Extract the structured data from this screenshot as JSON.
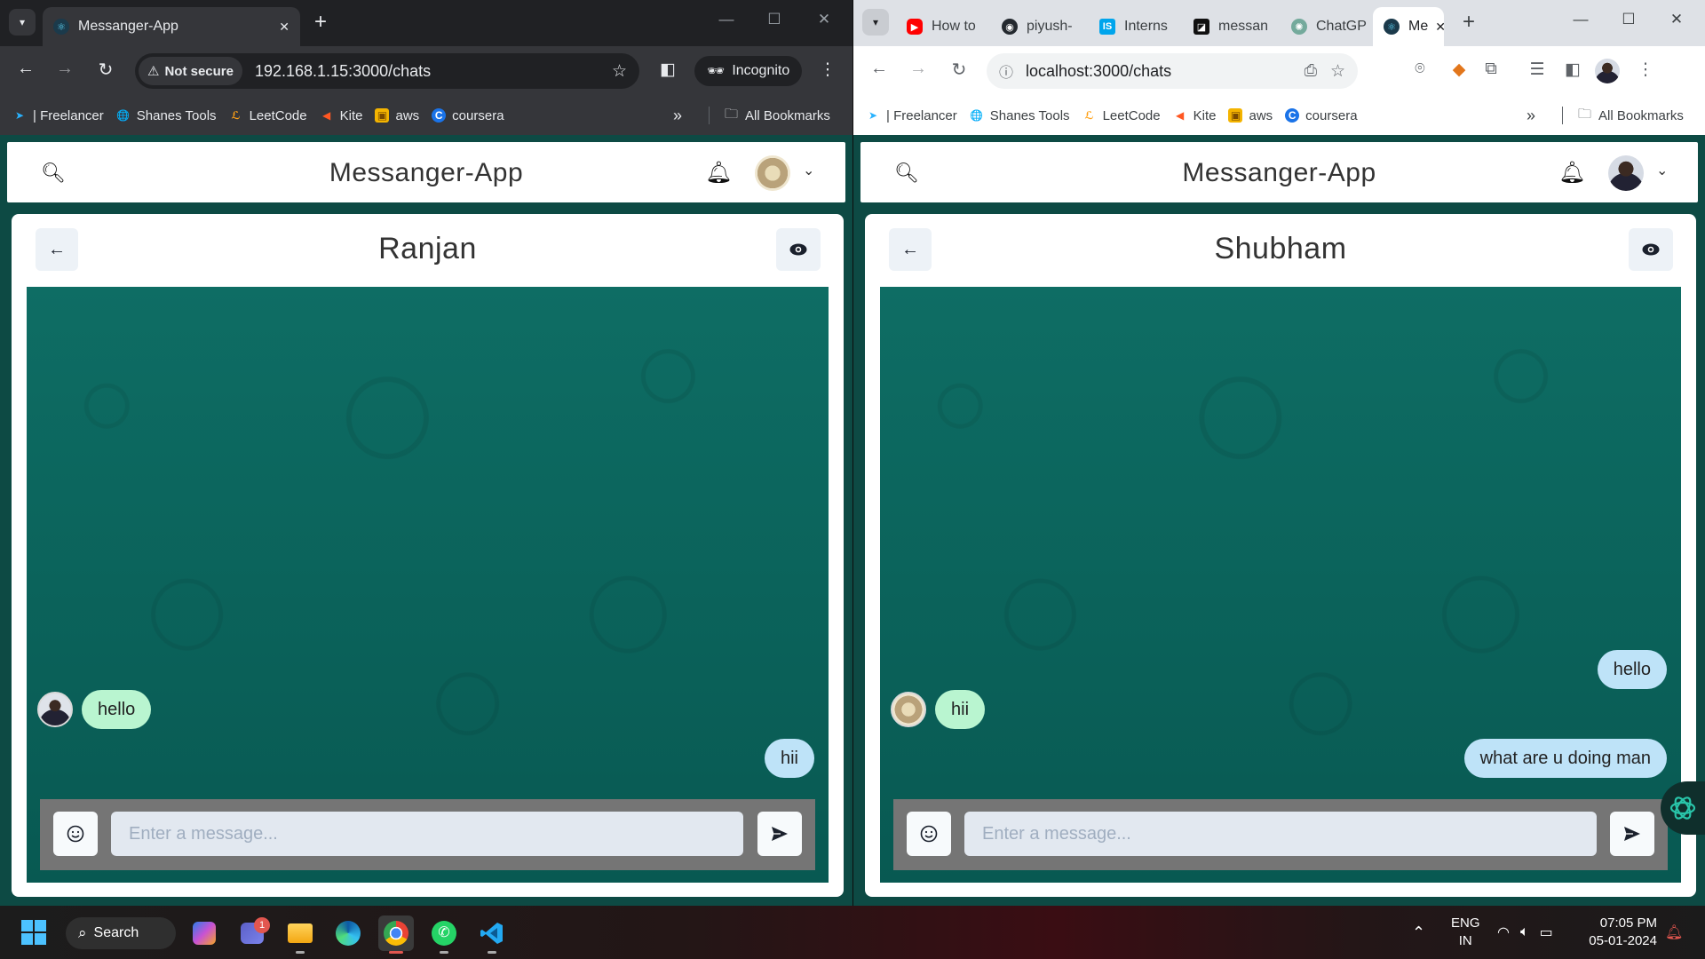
{
  "left_window": {
    "tab": {
      "title": "Messanger-App"
    },
    "address": {
      "security_label": "Not secure",
      "url": "192.168.1.15:3000/chats"
    },
    "incognito_label": "Incognito",
    "bookmarks": [
      "| Freelancer",
      "Shanes Tools",
      "LeetCode",
      "Kite",
      "aws",
      "coursera"
    ],
    "all_bookmarks": "All Bookmarks",
    "app": {
      "title": "Messanger-App",
      "chat": {
        "name": "Ranjan",
        "messages": [
          {
            "text": "hello",
            "direction": "in"
          },
          {
            "text": "hii",
            "direction": "out"
          }
        ],
        "input_placeholder": "Enter a message..."
      }
    }
  },
  "right_window": {
    "tabs": [
      {
        "title": "How to"
      },
      {
        "title": "piyush-"
      },
      {
        "title": "Interns"
      },
      {
        "title": "messan"
      },
      {
        "title": "ChatGP"
      },
      {
        "title": "Me"
      }
    ],
    "address": {
      "url": "localhost:3000/chats"
    },
    "bookmarks": [
      "| Freelancer",
      "Shanes Tools",
      "LeetCode",
      "Kite",
      "aws",
      "coursera"
    ],
    "all_bookmarks": "All Bookmarks",
    "app": {
      "title": "Messanger-App",
      "chat": {
        "name": "Shubham",
        "messages": [
          {
            "text": "hello",
            "direction": "out"
          },
          {
            "text": "hii",
            "direction": "in"
          },
          {
            "text": "what are u doing man",
            "direction": "out"
          }
        ],
        "input_placeholder": "Enter a message..."
      }
    }
  },
  "taskbar": {
    "search_label": "Search",
    "teams_badge": "1",
    "language": {
      "line1": "ENG",
      "line2": "IN"
    },
    "time": "07:05 PM",
    "date": "05-01-2024"
  },
  "colors": {
    "chat_bg": "#0b5f58",
    "incoming_bubble": "#b9f5d0",
    "outgoing_bubble": "#bee3f8",
    "accent_blue": "#4cc2ff"
  }
}
